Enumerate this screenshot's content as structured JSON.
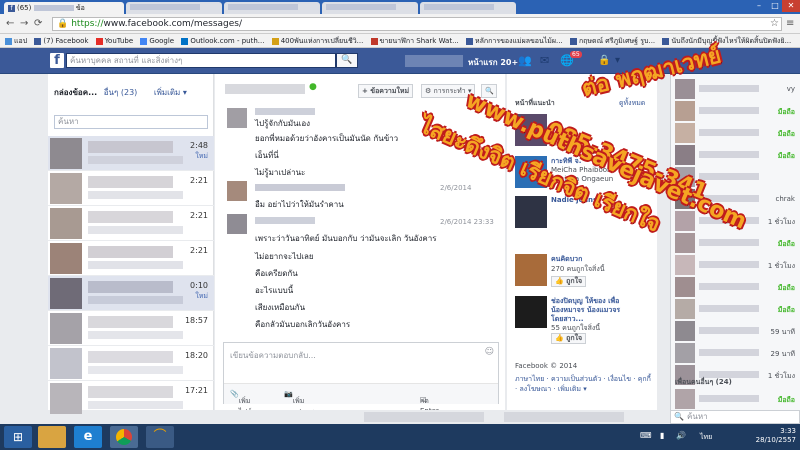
{
  "browser": {
    "tabs": [
      {
        "label": "(65)",
        "suffix": "ข้อ"
      },
      {
        "label": ""
      },
      {
        "label": ""
      },
      {
        "label": ""
      },
      {
        "label": ""
      }
    ],
    "url_scheme": "https://",
    "url_rest": "www.facebook.com/messages/",
    "bookmarks": [
      "แอป",
      "(7) Facebook",
      "YouTube",
      "Google",
      "Outlook.com - puth...",
      "400พันแห่งการเปลี่ยนชีวิ...",
      "ขายนาฬิกา Shark Wat...",
      "หลักการของแม่ผลขอนไม้ผ...",
      "กฤษดณ์ ศรีภูมิเศษฐ์ รูบ...",
      "นับถึงนักมีบุญขี้ฟังไหร่ให้ผิดสิ้นปิดฟังยิ..."
    ],
    "window": {
      "minimize": "–",
      "maximize": "□",
      "close": "✕"
    }
  },
  "fb": {
    "logo": "f",
    "search_placeholder": "ค้นหาบุคคล สถานที่ และสิ่งต่างๆ",
    "home": "หน้าแรก",
    "home_count": "20+",
    "notif_badge": "65"
  },
  "inbox": {
    "tab_inbox": "กล่องข้อค...",
    "tab_other": "อื่นๆ (23)",
    "more": "เพิ่มเติม ▾",
    "search_placeholder": "ค้นหา",
    "conversations": [
      {
        "time": "2:48",
        "new": "ใหม่",
        "selected": true
      },
      {
        "time": "2:21",
        "new": ""
      },
      {
        "time": "2:21",
        "new": ""
      },
      {
        "time": "2:21",
        "new": ""
      },
      {
        "time": "0:10",
        "new": "ใหม่",
        "selected": true
      },
      {
        "time": "18:57",
        "new": ""
      },
      {
        "time": "18:20",
        "new": ""
      },
      {
        "time": "17:21",
        "new": ""
      }
    ]
  },
  "thread": {
    "new_message": "+ ข้อความใหม่",
    "actions": "⚙ การกระทำ ▾",
    "search": "🔍",
    "messages": [
      "ไปรู้จักกับมันเอง",
      "ยอกพี่หมอด้วยว่าอังคารเป็นมันนัด กันข้าว",
      "เอ็นที่นี่",
      "ไม่รู้มาเปล่านะ",
      "อืม อย่าไปว่าให้มันรำคาน",
      "เพราะว่าวันอาทิตย์ มันบอกกับ ว่ามันจะเลิก วันอังคาร",
      "ไม่อยากจะไปเลย",
      "คือเครียดกัน",
      "อะไรแบบนี้",
      "เสียงเหมือนกัน",
      "คือกลัวมันบอกเลิกวันอังคาร"
    ],
    "date1": "2/6/2014",
    "date2": "2/6/2014 23:33",
    "composer_placeholder": "เขียนข้อความตอบกลับ...",
    "add_file": "เพิ่มไฟล์",
    "add_photo": "เพิ่มรูปภาพ",
    "enter_to_send": "กด Enter เพื่อส่ง",
    "smile": "☺"
  },
  "suggest": {
    "title": "หน้าที่แนะนำ",
    "see_all": "ดูทั้งหมด",
    "pages": [
      {
        "name": "",
        "line1": "",
        "line2": ""
      },
      {
        "name": "กาะทิพี จ.",
        "line1": "MeiCha Phaiboon",
        "line2": "Kanjana Ongaeun"
      },
      {
        "name": "Nadie jeans",
        "line1": "",
        "line2": ""
      },
      {
        "name": "คนคิดบวก",
        "line1": "270 คนถูกใจสิ่งนี้",
        "line2": ""
      },
      {
        "name": "ช่องปิดบุญ ให้ของ เพื่อ",
        "line1": "น้องหมาจร น้องแมวจร",
        "line2": "โดยสาว...",
        "likes": "55 คนถูกใจสิ่งนี้"
      }
    ],
    "like_label": "ถูกใจ",
    "footer_brand": "Facebook © 2014",
    "footer_links": "ภาษาไทย · ความเป็นส่วนตัว · เงื่อนไข · คุกกี้ · ลงโฆษณา · เพิ่มเติม ▾"
  },
  "chat": {
    "rows": [
      {
        "status": "vy",
        "online": false
      },
      {
        "status": "มือถือ",
        "online": true
      },
      {
        "status": "มือถือ",
        "online": true
      },
      {
        "status": "มือถือ",
        "online": true
      },
      {
        "status": "",
        "online": false
      },
      {
        "status": "chrak",
        "online": false
      },
      {
        "status": "1 ชั่วโมง",
        "online": false
      },
      {
        "status": "มือถือ",
        "online": true
      },
      {
        "status": "1 ชั่วโมง",
        "online": false
      },
      {
        "status": "มือถือ",
        "online": true
      },
      {
        "status": "มือถือ",
        "online": true
      },
      {
        "status": "59 นาที",
        "online": false
      },
      {
        "status": "29 นาที",
        "online": false
      },
      {
        "status": "1 ชั่วโมง",
        "online": false
      }
    ],
    "more_friends": "เพื่อนคนอื่นๆ (24)",
    "more_status": "มือถือ",
    "search_placeholder": "ค้นหา"
  },
  "watermark": {
    "line1": "ต่อ พฤฒาเวทย์",
    "line2": "085-3475-341",
    "line3": "www.puthsavejavet.com",
    "line4": "ไสยะดึงจิต เรียกจิต เรียกใจ"
  },
  "taskbar": {
    "time": "3:33",
    "date": "28/10/2557",
    "lang": "ไทย"
  },
  "colors": {
    "fb_blue": "#3b5998",
    "watermark_fill": "#f5a623",
    "watermark_stroke": "#c01c1c"
  }
}
